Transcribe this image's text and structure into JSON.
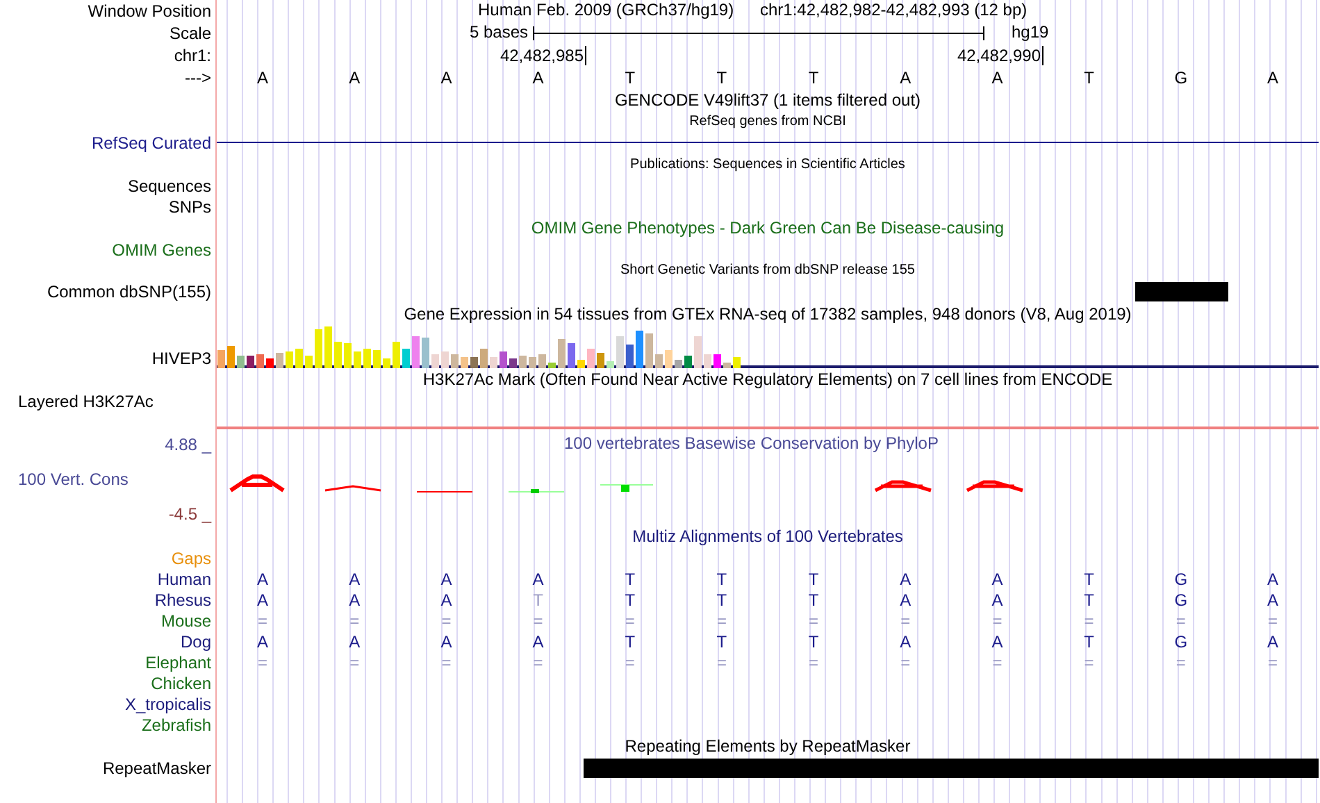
{
  "position": {
    "label": "Window Position",
    "assembly": "Human Feb. 2009 (GRCh37/hg19)",
    "range": "chr1:42,482,982-42,482,993 (12 bp)"
  },
  "scale": {
    "label": "Scale",
    "text": "5 bases",
    "assembly_short": "hg19"
  },
  "coordinates": {
    "label": "chr1:",
    "ticks": [
      "42,482,985",
      "42,482,990"
    ]
  },
  "sequence": {
    "label": "--->",
    "bases": [
      "A",
      "A",
      "A",
      "A",
      "T",
      "T",
      "T",
      "A",
      "A",
      "T",
      "G",
      "A"
    ]
  },
  "tracks": [
    {
      "kind": "title",
      "text": "GENCODE V49lift37 (1 items filtered out)"
    },
    {
      "kind": "subtitle",
      "text": "RefSeq genes from NCBI"
    },
    {
      "kind": "line",
      "label": "RefSeq Curated",
      "color": "#1c1c8c"
    },
    {
      "kind": "subtitle",
      "text": "Publications: Sequences in Scientific Articles"
    },
    {
      "kind": "label",
      "label": "Sequences"
    },
    {
      "kind": "label",
      "label": "SNPs"
    },
    {
      "kind": "title",
      "text": "OMIM Gene Phenotypes - Dark Green Can Be Disease-causing",
      "color": "#1a6e1a"
    },
    {
      "kind": "label",
      "label": "OMIM Genes",
      "color": "#1a6e1a"
    },
    {
      "kind": "subtitle",
      "text": "Short Genetic Variants from dbSNP release 155"
    },
    {
      "kind": "snp",
      "label": "Common dbSNP(155)"
    },
    {
      "kind": "title",
      "text": "Gene Expression in 54 tissues from GTEx RNA-seq of 17382 samples, 948 donors (V8, Aug 2019)"
    },
    {
      "kind": "expression",
      "label": "HIVEP3"
    },
    {
      "kind": "title",
      "text": "H3K27Ac Mark (Often Found Near Active Regulatory Elements) on 7 cell lines from ENCODE"
    },
    {
      "kind": "layered",
      "label": "Layered H3K27Ac"
    },
    {
      "kind": "conservation",
      "label": "100 Vert. Cons",
      "title": "100 vertebrates Basewise Conservation by PhyloP",
      "max": "4.88 _",
      "min": "-4.5 _"
    },
    {
      "kind": "alignment",
      "title": "Multiz Alignments of 100 Vertebrates",
      "species": [
        {
          "name": "Gaps",
          "color": "#e8900c"
        },
        {
          "name": "Human",
          "color": "#1c1c7c",
          "bases": [
            {
              "base": "A",
              "dim": false
            },
            {
              "base": "A",
              "dim": false
            },
            {
              "base": "A",
              "dim": false
            },
            {
              "base": "A",
              "dim": false
            },
            {
              "base": "T",
              "dim": false
            },
            {
              "base": "T",
              "dim": false
            },
            {
              "base": "T",
              "dim": false
            },
            {
              "base": "A",
              "dim": false
            },
            {
              "base": "A",
              "dim": false
            },
            {
              "base": "T",
              "dim": false
            },
            {
              "base": "G",
              "dim": false
            },
            {
              "base": "A",
              "dim": false
            }
          ]
        },
        {
          "name": "Rhesus",
          "color": "#1c1c7c",
          "bases": [
            {
              "base": "A",
              "dim": false
            },
            {
              "base": "A",
              "dim": false
            },
            {
              "base": "A",
              "dim": false
            },
            {
              "base": "T",
              "dim": true
            },
            {
              "base": "T",
              "dim": false
            },
            {
              "base": "T",
              "dim": false
            },
            {
              "base": "T",
              "dim": false
            },
            {
              "base": "A",
              "dim": false
            },
            {
              "base": "A",
              "dim": false
            },
            {
              "base": "T",
              "dim": false
            },
            {
              "base": "G",
              "dim": false
            },
            {
              "base": "A",
              "dim": false
            }
          ]
        },
        {
          "name": "Mouse",
          "color": "#1a6e1a",
          "bases": [
            {
              "base": "=",
              "dim": true
            },
            {
              "base": "=",
              "dim": true
            },
            {
              "base": "=",
              "dim": true
            },
            {
              "base": "=",
              "dim": true
            },
            {
              "base": "=",
              "dim": true
            },
            {
              "base": "=",
              "dim": true
            },
            {
              "base": "=",
              "dim": true
            },
            {
              "base": "=",
              "dim": true
            },
            {
              "base": "=",
              "dim": true
            },
            {
              "base": "=",
              "dim": true
            },
            {
              "base": "=",
              "dim": true
            },
            {
              "base": "=",
              "dim": true
            }
          ]
        },
        {
          "name": "Dog",
          "color": "#1c1c7c",
          "bases": [
            {
              "base": "A",
              "dim": false
            },
            {
              "base": "A",
              "dim": false
            },
            {
              "base": "A",
              "dim": false
            },
            {
              "base": "A",
              "dim": false
            },
            {
              "base": "T",
              "dim": false
            },
            {
              "base": "T",
              "dim": false
            },
            {
              "base": "T",
              "dim": false
            },
            {
              "base": "A",
              "dim": false
            },
            {
              "base": "A",
              "dim": false
            },
            {
              "base": "T",
              "dim": false
            },
            {
              "base": "G",
              "dim": false
            },
            {
              "base": "A",
              "dim": false
            }
          ]
        },
        {
          "name": "Elephant",
          "color": "#1a6e1a",
          "bases": [
            {
              "base": "=",
              "dim": true
            },
            {
              "base": "=",
              "dim": true
            },
            {
              "base": "=",
              "dim": true
            },
            {
              "base": "=",
              "dim": true
            },
            {
              "base": "=",
              "dim": true
            },
            {
              "base": "=",
              "dim": true
            },
            {
              "base": "=",
              "dim": true
            },
            {
              "base": "=",
              "dim": true
            },
            {
              "base": "=",
              "dim": true
            },
            {
              "base": "=",
              "dim": true
            },
            {
              "base": "=",
              "dim": true
            },
            {
              "base": "=",
              "dim": true
            }
          ]
        },
        {
          "name": "Chicken",
          "color": "#1a6e1a"
        },
        {
          "name": "X_tropicalis",
          "color": "#1c1c7c"
        },
        {
          "name": "Zebrafish",
          "color": "#1a6e1a"
        }
      ]
    },
    {
      "kind": "title",
      "text": "Repeating Elements by RepeatMasker"
    },
    {
      "kind": "repeat",
      "label": "RepeatMasker"
    }
  ]
}
